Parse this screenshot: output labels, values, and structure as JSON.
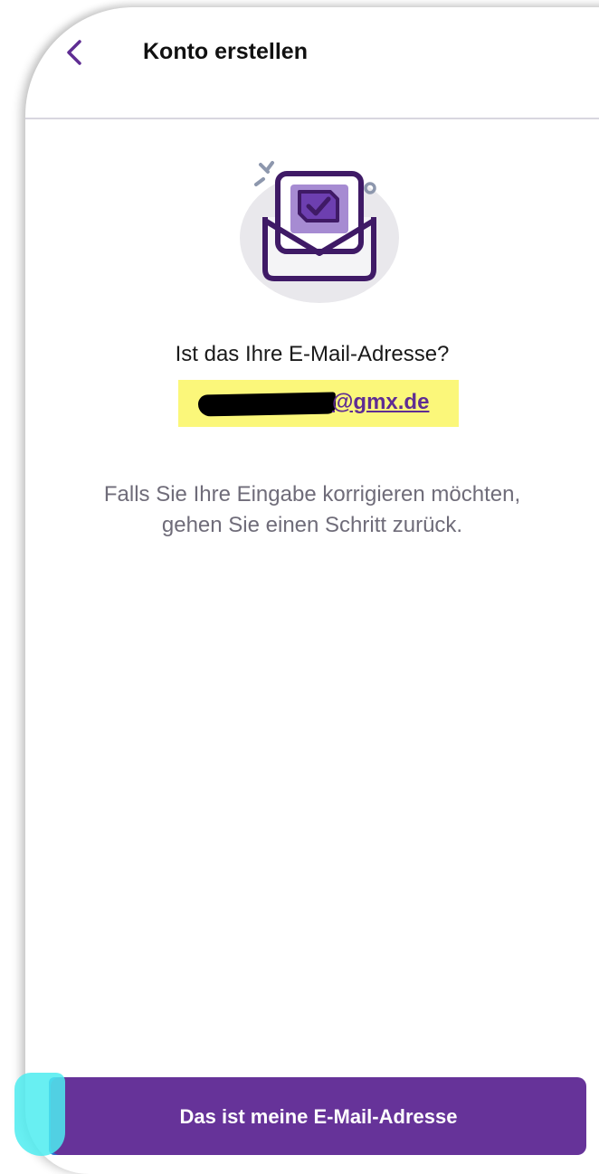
{
  "header": {
    "title": "Konto erstellen"
  },
  "confirmation": {
    "question": "Ist das Ihre E-Mail-Adresse?",
    "email_domain": "@gmx.de",
    "hint_line1": "Falls Sie Ihre Eingabe korrigieren möchten,",
    "hint_line2": "gehen Sie einen Schritt zurück."
  },
  "actions": {
    "confirm_label": "Das ist meine E-Mail-Adresse"
  },
  "colors": {
    "accent": "#663399",
    "highlight": "#fbf77a",
    "hint_text": "#6f6c79"
  },
  "icons": {
    "back": "chevron-left-icon",
    "illustration": "envelope-check-icon"
  }
}
